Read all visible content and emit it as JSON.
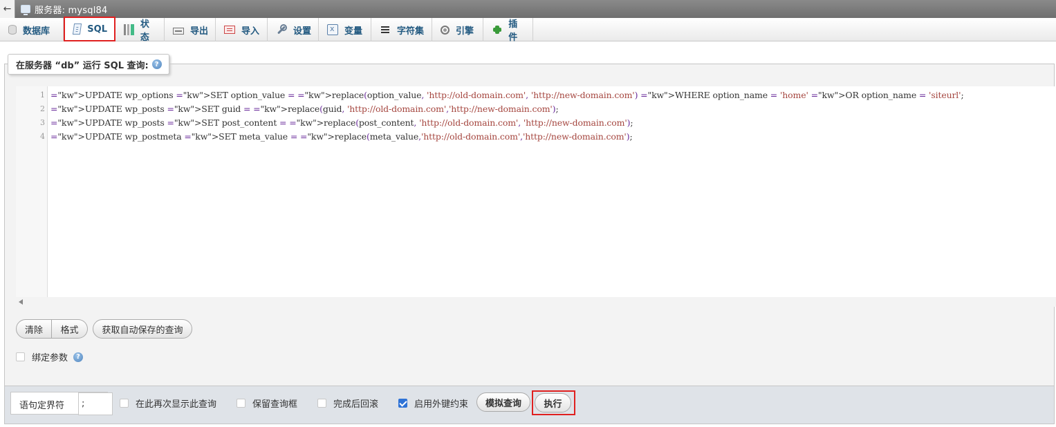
{
  "window": {
    "title": "服务器: mysql84",
    "back_icon": "arrow-left-icon"
  },
  "tabs": [
    {
      "label": "数据库",
      "icon": "database-icon"
    },
    {
      "label": "SQL",
      "icon": "sql-icon",
      "active": true
    },
    {
      "label": "状态",
      "icon": "status-icon"
    },
    {
      "label": "导出",
      "icon": "export-icon"
    },
    {
      "label": "导入",
      "icon": "import-icon"
    },
    {
      "label": "设置",
      "icon": "wrench-icon"
    },
    {
      "label": "变量",
      "icon": "variables-icon"
    },
    {
      "label": "字符集",
      "icon": "charset-icon"
    },
    {
      "label": "引擎",
      "icon": "engine-icon"
    },
    {
      "label": "插件",
      "icon": "puzzle-icon"
    }
  ],
  "query_box": {
    "legend": "在服务器 “db” 运行 SQL 查询:",
    "line_numbers": [
      "1",
      "2",
      "3",
      "4"
    ],
    "lines": [
      "UPDATE wp_options SET option_value = replace(option_value, 'http://old-domain.com', 'http://new-domain.com') WHERE option_name = 'home' OR option_name = 'siteurl';",
      "UPDATE wp_posts SET guid = replace(guid, 'http://old-domain.com','http://new-domain.com');",
      "UPDATE wp_posts SET post_content = replace(post_content, 'http://old-domain.com', 'http://new-domain.com');",
      "UPDATE wp_postmeta SET meta_value = replace(meta_value,'http://old-domain.com','http://new-domain.com');"
    ]
  },
  "buttons": {
    "clear": "清除",
    "format": "格式",
    "get_autosaved": "获取自动保存的查询",
    "simulate": "模拟查询",
    "go": "执行"
  },
  "bind_params": {
    "label": "绑定参数",
    "checked": false
  },
  "bottom": {
    "delimiter_label": "语句定界符",
    "delimiter_value": ";",
    "show_again": {
      "label": "在此再次显示此查询",
      "checked": false
    },
    "retain_box": {
      "label": "保留查询框",
      "checked": false
    },
    "rollback": {
      "label": "完成后回滚",
      "checked": false
    },
    "fk_checks": {
      "label": "启用外键约束",
      "checked": true
    }
  },
  "colors": {
    "active_highlight": "#e0201f",
    "tab_text": "#235a81",
    "keyword": "#6a2b9b",
    "string": "#a5463f"
  }
}
